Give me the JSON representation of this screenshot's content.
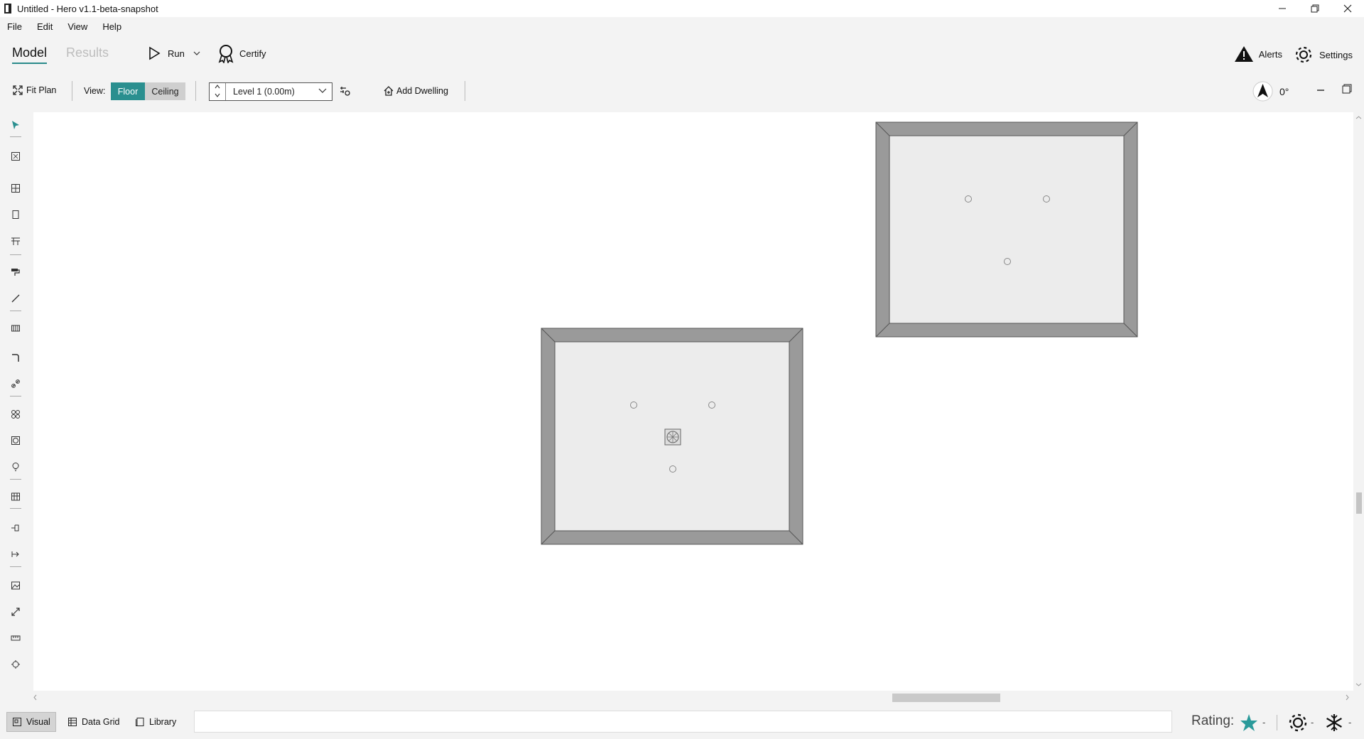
{
  "window": {
    "title": "Untitled - Hero v1.1-beta-snapshot",
    "controls": [
      "minimize-icon",
      "restore-icon",
      "close-icon"
    ]
  },
  "menu": [
    "File",
    "Edit",
    "View",
    "Help"
  ],
  "mainbar": {
    "tabs": [
      {
        "label": "Model",
        "active": true
      },
      {
        "label": "Results",
        "active": false
      }
    ],
    "run_label": "Run",
    "certify_label": "Certify",
    "alerts_label": "Alerts",
    "settings_label": "Settings"
  },
  "toolbar": {
    "fit_plan_label": "Fit Plan",
    "view_label": "View:",
    "floor_label": "Floor",
    "ceiling_label": "Ceiling",
    "active_view": "Floor",
    "level_value": "Level 1 (0.00m)",
    "add_dwelling_label": "Add Dwelling",
    "rotation_value": "0°"
  },
  "left_tools": [
    "select-pointer-icon",
    "room-icon",
    "floor-grid-icon",
    "door-icon",
    "stairs-icon",
    "paint-roller-icon",
    "line-icon",
    "radiator-icon",
    "pipe-icon",
    "link-icon",
    "fan-icon",
    "vent-grille-icon",
    "lightbulb-icon",
    "ceiling-grid-icon",
    "route-icon",
    "connector-icon",
    "image-icon",
    "resize-icon",
    "ruler-icon",
    "origin-icon"
  ],
  "statusbar": {
    "visual_label": "Visual",
    "data_grid_label": "Data Grid",
    "library_label": "Library",
    "status_text": "",
    "rating_label": "Rating:",
    "rating_value": "-",
    "heating_value": "-",
    "cooling_value": "-"
  },
  "colors": {
    "accent": "#2a8f8f",
    "wall": "#9a9a9a",
    "room_fill": "#ececec",
    "canvas": "#ffffff"
  }
}
